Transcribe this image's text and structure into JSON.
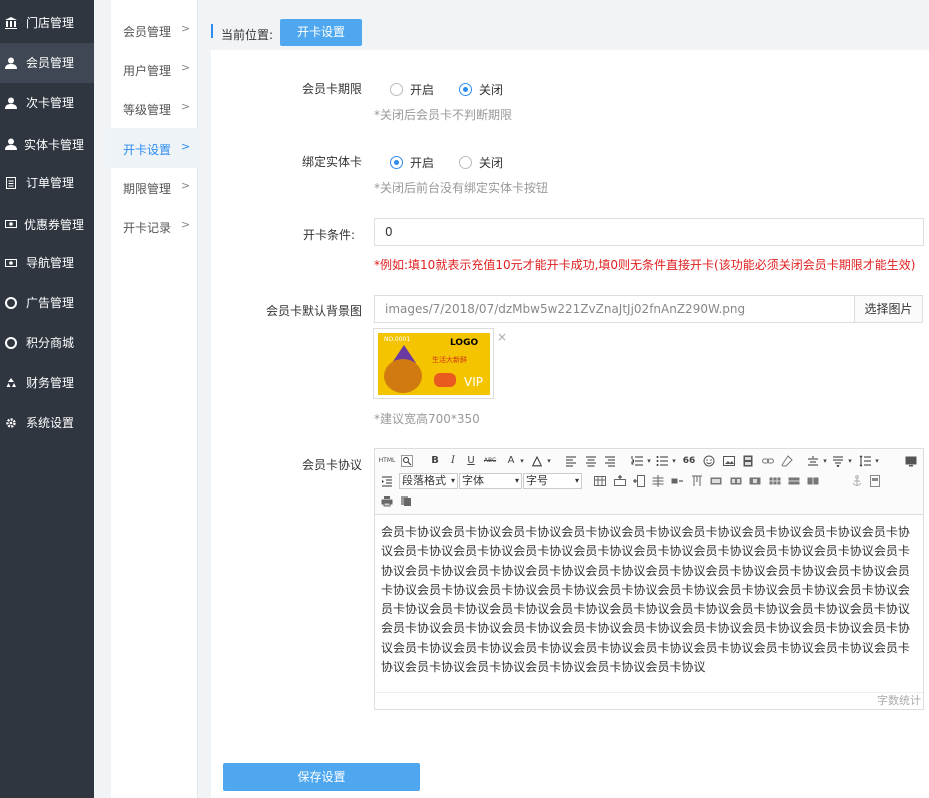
{
  "sidebar": {
    "items": [
      {
        "label": "门店管理",
        "icon": "bank-icon"
      },
      {
        "label": "会员管理",
        "icon": "user-icon"
      },
      {
        "label": "次卡管理",
        "icon": "user-icon"
      },
      {
        "label": "实体卡管理",
        "icon": "user-icon"
      },
      {
        "label": "订单管理",
        "icon": "document-icon"
      },
      {
        "label": "优惠券管理",
        "icon": "coupon-icon"
      },
      {
        "label": "导航管理",
        "icon": "coupon-icon"
      },
      {
        "label": "广告管理",
        "icon": "lifebuoy-icon"
      },
      {
        "label": "积分商城",
        "icon": "lifebuoy-icon"
      },
      {
        "label": "财务管理",
        "icon": "recycle-icon"
      },
      {
        "label": "系统设置",
        "icon": "gear-icon"
      }
    ],
    "active_index": 1
  },
  "submenu": {
    "items": [
      {
        "label": "会员管理"
      },
      {
        "label": "用户管理"
      },
      {
        "label": "等级管理"
      },
      {
        "label": "开卡设置"
      },
      {
        "label": "期限管理"
      },
      {
        "label": "开卡记录"
      }
    ],
    "chevron": ">",
    "active_index": 3
  },
  "breadcrumb": {
    "label": "当前位置:",
    "current": "开卡设置"
  },
  "form": {
    "expiry": {
      "label": "会员卡期限",
      "option_on": "开启",
      "option_off": "关闭",
      "selected": "off",
      "hint": "*关闭后会员卡不判断期限"
    },
    "bind_card": {
      "label": "绑定实体卡",
      "option_on": "开启",
      "option_off": "关闭",
      "selected": "on",
      "hint": "*关闭后前台没有绑定实体卡按钮"
    },
    "condition": {
      "label": "开卡条件:",
      "value": "0",
      "hint": "*例如:填10就表示充值10元才能开卡成功,填0则无条件直接开卡(该功能必须关闭会员卡期限才能生效)"
    },
    "background": {
      "label": "会员卡默认背景图",
      "path": "images/7/2018/07/dzMbw5w221ZvZnaJtJj02fnAnZ290W.png",
      "button": "选择图片",
      "remove": "×",
      "hint": "*建议宽高700*350",
      "card_logo": "LOGO",
      "card_vip": "VIP",
      "card_small": "NO.0001",
      "card_text": "生活大新鲜"
    },
    "agreement": {
      "label": "会员卡协议",
      "toolbar": {
        "paragraph_format": "段落格式",
        "font_family": "字体",
        "font_size": "字号",
        "html_label": "HTML",
        "bold": "B",
        "italic": "I",
        "underline": "U",
        "strike": "ABC",
        "font_color": "A",
        "quote": "66"
      },
      "content": "会员卡协议会员卡协议会员卡协议会员卡协议会员卡协议会员卡协议会员卡协议会员卡协议会员卡协议会员卡协议会员卡协议会员卡协议会员卡协议会员卡协议会员卡协议会员卡协议会员卡协议会员卡协议会员卡协议会员卡协议会员卡协议会员卡协议会员卡协议会员卡协议会员卡协议会员卡协议会员卡协议会员卡协议会员卡协议会员卡协议会员卡协议会员卡协议会员卡协议会员卡协议会员卡协议会员卡协议会员卡协议会员卡协议会员卡协议会员卡协议会员卡协议会员卡协议会员卡协议会员卡协议会员卡协议会员卡协议会员卡协议会员卡协议会员卡协议会员卡协议会员卡协议会员卡协议会员卡协议会员卡协议会员卡协议会员卡协议会员卡协议会员卡协议会员卡协议会员卡协议会员卡协议会员卡协议会员卡协议会员卡协议会员卡协议会员卡协议会员卡协议",
      "word_count": "字数统计"
    }
  },
  "save_button": "保存设置",
  "colors": {
    "sidebar_bg": "#2f3640",
    "accent": "#2d8cf0",
    "button": "#4fa8ef",
    "warning": "#e02020"
  }
}
